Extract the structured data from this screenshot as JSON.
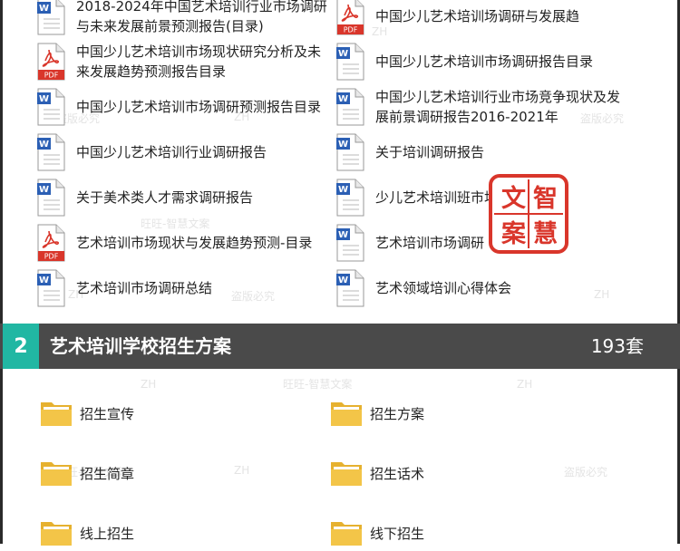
{
  "documents": [
    {
      "title": "2018-2024年中国艺术培训行业市场调研与未来发展前景预测报告(目录)",
      "icon": "word-doc-icon"
    },
    {
      "title": "中国少儿艺术培训场调研与发展趋",
      "icon": "pdf-icon"
    },
    {
      "title": "中国少儿艺术培训市场现状研究分析及未来发展趋势预测报告目录",
      "icon": "pdf-icon"
    },
    {
      "title": "中国少儿艺术培训市场调研报告目录",
      "icon": "word-doc-icon"
    },
    {
      "title": "中国少儿艺术培训市场调研预测报告目录",
      "icon": "word-doc-icon"
    },
    {
      "title": "中国少儿艺术培训行业市场竞争现状及发展前景调研报告2016-2021年",
      "icon": "word-doc-icon"
    },
    {
      "title": "中国少儿艺术培训行业调研报告",
      "icon": "word-doc-icon"
    },
    {
      "title": "关于培训调研报告",
      "icon": "word-doc-icon"
    },
    {
      "title": "关于美术类人才需求调研报告",
      "icon": "word-doc-icon"
    },
    {
      "title": "少儿艺术培训班市场调查表",
      "icon": "word-doc-icon"
    },
    {
      "title": "艺术培训市场现状与发展趋势预测-目录",
      "icon": "pdf-icon"
    },
    {
      "title": "艺术培训市场调研",
      "icon": "word-doc-icon"
    },
    {
      "title": "艺术培训市场调研总结",
      "icon": "word-doc-icon"
    },
    {
      "title": "艺术领域培训心得体会",
      "icon": "word-doc-icon"
    }
  ],
  "section": {
    "number": "2",
    "title": "艺术培训学校招生方案",
    "count": "193套"
  },
  "folders": [
    {
      "label": "招生宣传"
    },
    {
      "label": "招生方案"
    },
    {
      "label": "招生简章"
    },
    {
      "label": "招生话术"
    },
    {
      "label": "线上招生"
    },
    {
      "label": "线下招生"
    }
  ],
  "seal": {
    "chars": [
      "文",
      "智",
      "案",
      "慧"
    ],
    "color": "#d9362b"
  },
  "watermarks": [
    "旺旺-智慧文案",
    "盗版必究",
    "ZH"
  ],
  "colors": {
    "accent": "#21b7a3",
    "section_bar": "#4a4a4a",
    "folder": "#f3c548",
    "word_blue": "#2b5fb4",
    "pdf_red": "#d9362b"
  }
}
